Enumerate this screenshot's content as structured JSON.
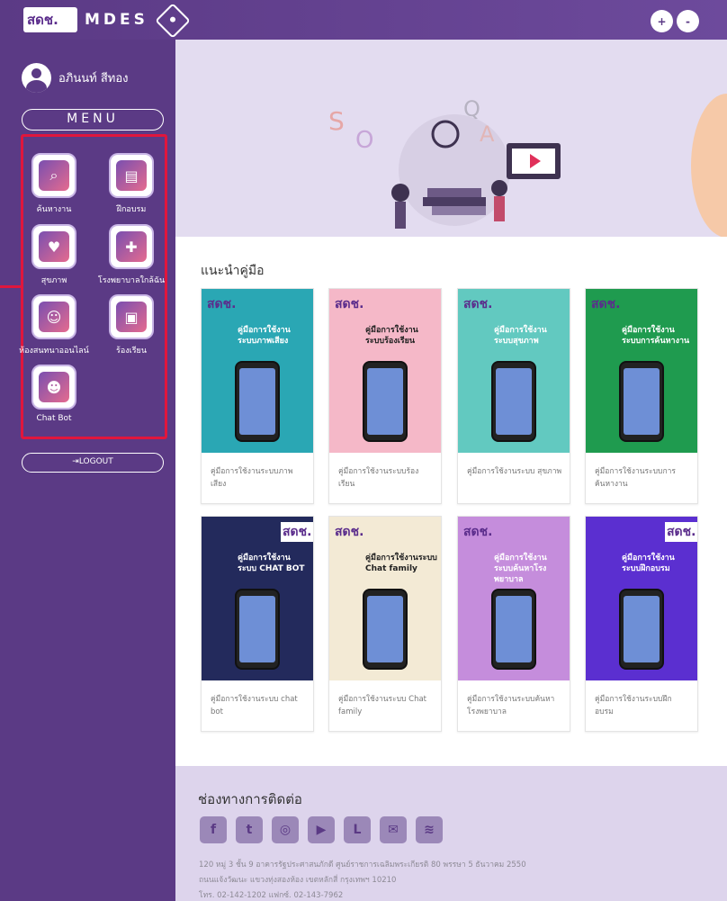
{
  "header": {
    "logo_text": "สดช.",
    "brand": "MDES",
    "btn_plus": "+",
    "btn_minus": "-"
  },
  "sidebar": {
    "username": "อภินนท์ สีทอง",
    "menu_label": "MENU",
    "items": [
      {
        "label": "ค้นหางาน",
        "icon": "job-search-icon"
      },
      {
        "label": "ฝึกอบรม",
        "icon": "training-icon"
      },
      {
        "label": "สุขภาพ",
        "icon": "health-icon"
      },
      {
        "label": "โรงพยาบาลใกล้ฉัน",
        "icon": "hospital-icon"
      },
      {
        "label": "ห้องสนทนาออนไลน์",
        "icon": "chat-room-icon"
      },
      {
        "label": "ร้องเรียน",
        "icon": "complaint-icon"
      },
      {
        "label": "Chat Bot",
        "icon": "chatbot-icon"
      }
    ],
    "logout_label": "LOGOUT"
  },
  "main": {
    "section_title": "แนะนำคู่มือ",
    "cards": [
      {
        "label": "คู่มือการใช้งานระบบภาพ เสียง",
        "cover_title": "คู่มือการใช้งาน ระบบภาพเสียง",
        "logo": "สดช.",
        "color": "#2aa7b4"
      },
      {
        "label": "คู่มือการใช้งานระบบร้อง เรียน",
        "cover_title": "คู่มือการใช้งาน ระบบร้องเรียน",
        "logo": "สดช.",
        "color": "#f5b8c8"
      },
      {
        "label": "คู่มือการใช้งานระบบ สุขภาพ",
        "cover_title": "คู่มือการใช้งาน ระบบสุขภาพ",
        "logo": "สดช.",
        "color": "#62c9c0"
      },
      {
        "label": "คู่มือการใช้งานระบบการ ค้นหางาน",
        "cover_title": "คู่มือการใช้งาน ระบบการค้นหางาน",
        "logo": "สดช.",
        "color": "#1f9b4f"
      },
      {
        "label": "คู่มือการใช้งานระบบ chat bot",
        "cover_title": "คู่มือการใช้งาน ระบบ CHAT BOT",
        "logo": "สดช.",
        "color": "#232a5c"
      },
      {
        "label": "คู่มือการใช้งานระบบ Chat family",
        "cover_title": "คู่มือการใช้งานระบบ Chat family",
        "logo": "สดช.",
        "color": "#f3ead5"
      },
      {
        "label": "คู่มือการใช้งานระบบค้นหา โรงพยาบาล",
        "cover_title": "คู่มือการใช้งาน ระบบค้นหาโรงพยาบาล",
        "logo": "สดช.",
        "color": "#c58ddc"
      },
      {
        "label": "คู่มือการใช้งานระบบฝึก อบรม",
        "cover_title": "คู่มือการใช้งาน ระบบฝึกอบรม",
        "logo": "สดช.",
        "color": "#5b2fd0"
      }
    ]
  },
  "footer": {
    "title": "ช่องทางการติดต่อ",
    "social": [
      "facebook-icon",
      "twitter-icon",
      "instagram-icon",
      "youtube-icon",
      "line-icon",
      "email-icon",
      "rss-icon"
    ],
    "social_glyphs": [
      "f",
      "t",
      "◎",
      "▶",
      "L",
      "✉",
      "≋"
    ],
    "address_1": "120 หมู่ 3 ชั้น 9 อาคารรัฐประศาสนภักดี ศูนย์ราชการเฉลิมพระเกียรติ 80 พรรษา 5 ธันวาคม 2550",
    "address_2": "ถนนแจ้งวัฒนะ แขวงทุ่งสองห้อง เขตหลักสี่ กรุงเทพฯ 10210",
    "phone": "โทร. 02-142-1202 แฟกซ์. 02-143-7962"
  }
}
